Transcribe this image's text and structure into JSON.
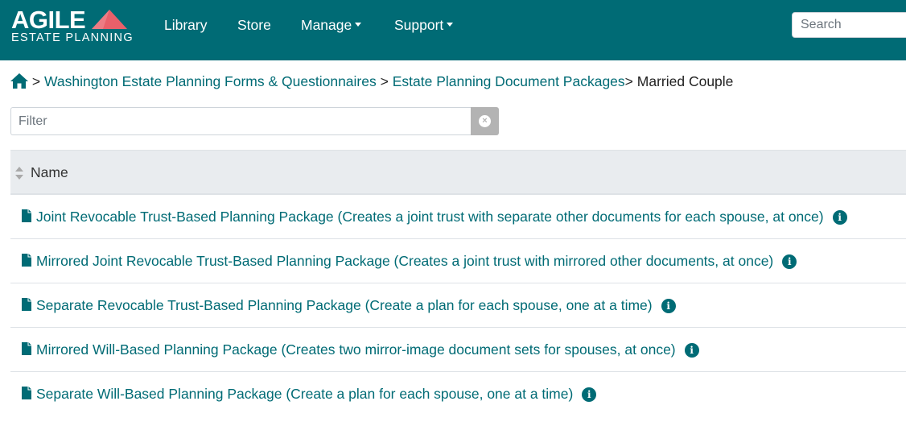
{
  "brand": {
    "name": "AGILE",
    "tagline": "ESTATE PLANNING",
    "colors": {
      "primary": "#006b75",
      "accent": "#e8606a"
    }
  },
  "nav": {
    "library": "Library",
    "store": "Store",
    "manage": "Manage",
    "support": "Support",
    "search_placeholder": "Search"
  },
  "breadcrumb": {
    "home_icon": "home-icon",
    "sep": ">",
    "crumb1": "Washington Estate Planning Forms & Questionnaires",
    "crumb2": "Estate Planning Document Packages",
    "current": "Married Couple"
  },
  "filter": {
    "placeholder": "Filter",
    "clear_icon": "clear-circle-icon"
  },
  "table": {
    "column_header": "Name",
    "rows": [
      {
        "label": "Joint Revocable Trust-Based Planning Package (Creates a joint trust with separate other documents for each spouse, at once)"
      },
      {
        "label": "Mirrored Joint Revocable Trust-Based Planning Package (Creates a joint trust with mirrored other documents, at once)"
      },
      {
        "label": "Separate Revocable Trust-Based Planning Package (Create a plan for each spouse, one at a time)"
      },
      {
        "label": "Mirrored Will-Based Planning Package (Creates two mirror-image document sets for spouses, at once)"
      },
      {
        "label": "Separate Will-Based Planning Package (Create a plan for each spouse, one at a time)"
      }
    ]
  }
}
